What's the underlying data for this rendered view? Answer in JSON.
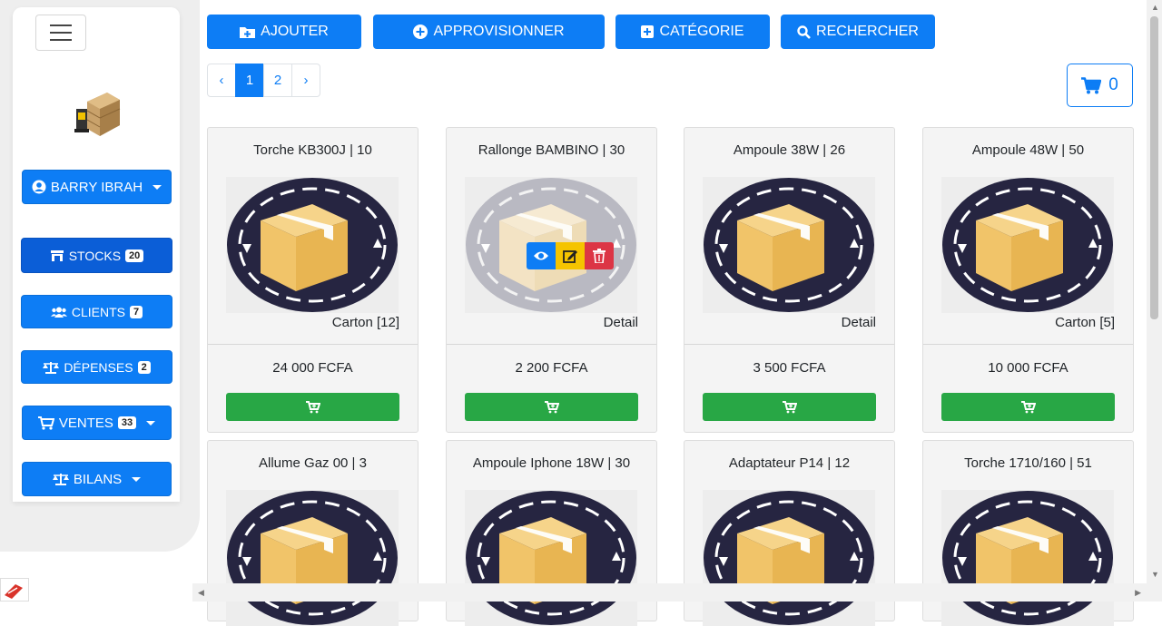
{
  "sidebar": {
    "user_label": "BARRY IBRAH",
    "items": [
      {
        "label": "STOCKS",
        "count": "20"
      },
      {
        "label": "CLIENTS",
        "count": "7"
      },
      {
        "label": "DÉPENSES",
        "count": "2"
      },
      {
        "label": "VENTES",
        "count": "33"
      },
      {
        "label": "BILANS"
      }
    ]
  },
  "toolbar": {
    "add_label": "AJOUTER",
    "supply_label": "APPROVISIONNER",
    "category_label": "CATÉGORIE",
    "search_label": "RECHERCHER"
  },
  "pagination": {
    "prev": "‹",
    "pages": [
      "1",
      "2"
    ],
    "next": "›",
    "current": "1"
  },
  "cart": {
    "count": "0"
  },
  "products": [
    {
      "name": "Torche KB300J | 10",
      "unit": "Carton [12]",
      "price": "24 000 FCFA"
    },
    {
      "name": "Rallonge BAMBINO | 30",
      "unit": "Detail",
      "price": "2 200 FCFA"
    },
    {
      "name": "Ampoule 38W | 26",
      "unit": "Detail",
      "price": "3 500 FCFA"
    },
    {
      "name": "Ampoule 48W | 50",
      "unit": "Carton [5]",
      "price": "10 000 FCFA"
    },
    {
      "name": "Allume Gaz 00 | 3"
    },
    {
      "name": "Ampoule Iphone 18W | 30"
    },
    {
      "name": "Adaptateur P14 | 12"
    },
    {
      "name": "Torche 1710/160 | 51"
    }
  ],
  "colors": {
    "primary": "#0d7df5",
    "success": "#28a745",
    "warning": "#f5c400",
    "danger": "#dc3545"
  }
}
